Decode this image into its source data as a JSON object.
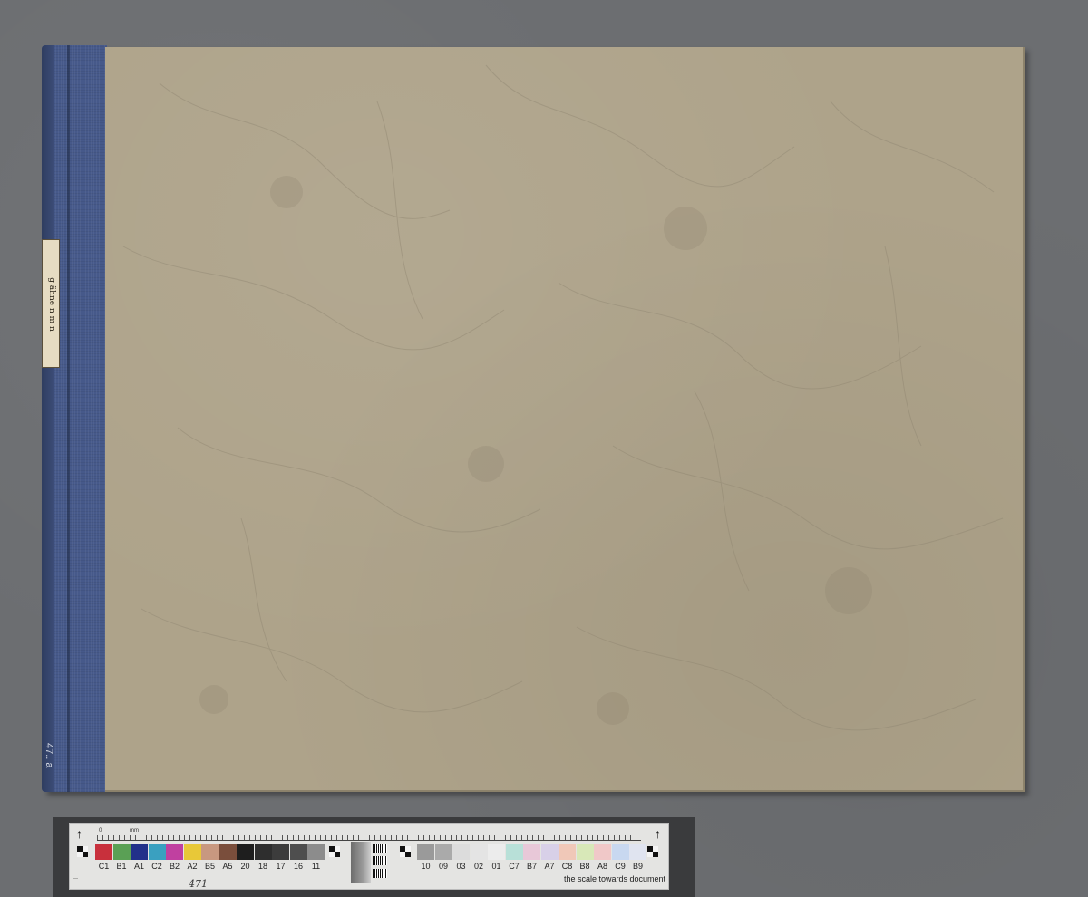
{
  "spine": {
    "label_text": "g  ähne  n  m  n",
    "bottom_mark": "47.. a"
  },
  "target": {
    "left_patches": [
      {
        "label": "C1",
        "color": "#c8303c"
      },
      {
        "label": "B1",
        "color": "#5aa055"
      },
      {
        "label": "A1",
        "color": "#22308a"
      },
      {
        "label": "C2",
        "color": "#3aa0c0"
      },
      {
        "label": "B2",
        "color": "#c040a0"
      },
      {
        "label": "A2",
        "color": "#e8c838"
      },
      {
        "label": "B5",
        "color": "#c89880"
      },
      {
        "label": "A5",
        "color": "#7a4e3c"
      },
      {
        "label": "20",
        "color": "#1e1e1e"
      },
      {
        "label": "18",
        "color": "#2e2e2e"
      },
      {
        "label": "17",
        "color": "#3c3c3c"
      },
      {
        "label": "16",
        "color": "#4e4e4e"
      },
      {
        "label": "11",
        "color": "#8c8c8c"
      }
    ],
    "right_patches": [
      {
        "label": "10",
        "color": "#9a9a9a"
      },
      {
        "label": "09",
        "color": "#aaaaaa"
      },
      {
        "label": "03",
        "color": "#dcdcdc"
      },
      {
        "label": "02",
        "color": "#e4e4e4"
      },
      {
        "label": "01",
        "color": "#ececec"
      },
      {
        "label": "C7",
        "color": "#b8e0d8"
      },
      {
        "label": "B7",
        "color": "#e8c8d8"
      },
      {
        "label": "A7",
        "color": "#d8d0e8"
      },
      {
        "label": "C8",
        "color": "#f0c8b8"
      },
      {
        "label": "B8",
        "color": "#d8e8b8"
      },
      {
        "label": "A8",
        "color": "#f0c8c8"
      },
      {
        "label": "C9",
        "color": "#c8d8f0"
      },
      {
        "label": "B9",
        "color": "#e0e4f0"
      }
    ],
    "ruler_unit": "mm",
    "ruler_start": "0",
    "handwritten_number": "471",
    "scale_note": "the scale towards document"
  }
}
